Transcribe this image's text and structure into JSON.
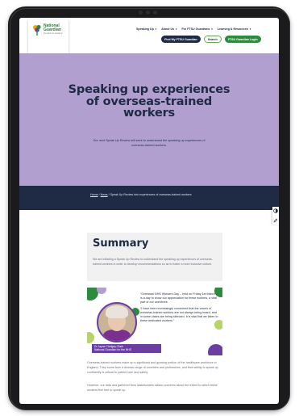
{
  "header": {
    "logo_name_line1": "National",
    "logo_name_line2": "Guardian",
    "logo_tagline": "Freedom to speak up",
    "nav": [
      {
        "label": "Speaking Up"
      },
      {
        "label": "About Us"
      },
      {
        "label": "For FTSU Guardians"
      },
      {
        "label": "Learning & Resources"
      }
    ],
    "buttons": {
      "find": "Find My FTSU Guardian",
      "search": "Search",
      "login": "FTSU Guardian Login"
    }
  },
  "hero": {
    "title": "Speaking up experiences of overseas-trained workers",
    "subtitle": "Our next Speak Up Review will seek to understand the speaking up experiences of overseas-trained workers."
  },
  "breadcrumb": {
    "home": "Home",
    "news": "News",
    "current": "Speak Up Review into experiences of overseas-trained workers",
    "separator": "/"
  },
  "summary": {
    "title": "Summary",
    "text": "We are initiating a Speak Up Review to understand the speaking up experiences of overseas-trained workers in order to develop recommendations so as to foster a more inclusive culture."
  },
  "quote": {
    "paragraph1": "“Overseas NHS Workers Day – held on Friday 1st March – is a day to show our appreciation for these workers, a vital part of our workforce.",
    "paragraph2": "“I have been increasingly concerned that the voices of overseas-trained workers are not always being heard, and in some cases are being silenced. It is vital that we listen to these dedicated workers.”",
    "caption_name": "Dr Jayne Chidgey-Clark",
    "caption_role": "National Guardian for the NHS"
  },
  "body": {
    "paragraph1": "Overseas-trained workers make up a significant and growing portion of the healthcare workforce in England. They come from a diverse range of countries and professions, and their ability to speak up confidently is critical to patient care and safety.",
    "paragraph2": "However, our data and gathered from stakeholders raises concerns about the extent to which these workers feel free to speak up."
  },
  "colors": {
    "navy": "#1f2a44",
    "lavender": "#b19fcf",
    "green": "#2e8b3e",
    "purple": "#6a3fa0"
  },
  "icons": {
    "contrast": "contrast-icon",
    "edit": "pencil-icon"
  }
}
